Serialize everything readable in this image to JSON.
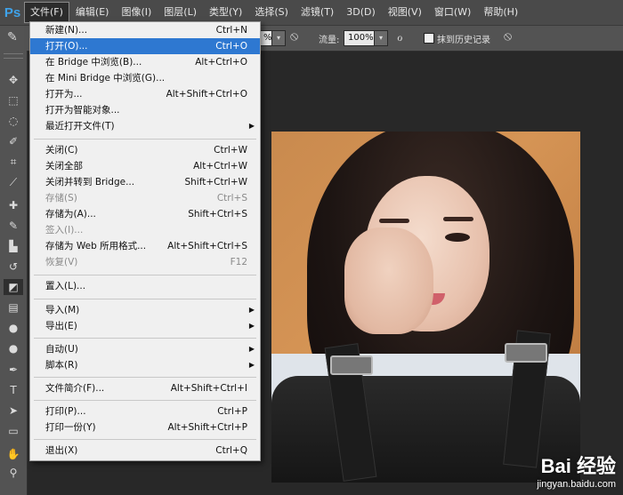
{
  "menubar": {
    "logo": "Ps",
    "items": [
      "文件(F)",
      "编辑(E)",
      "图像(I)",
      "图层(L)",
      "类型(Y)",
      "选择(S)",
      "滤镜(T)",
      "3D(D)",
      "视图(V)",
      "窗口(W)",
      "帮助(H)"
    ]
  },
  "options": {
    "opacity_value": "%",
    "flow_label": "流量:",
    "flow_value": "100%",
    "history_label": "抹到历史记录"
  },
  "file_menu": {
    "items": [
      {
        "label": "新建(N)...",
        "shortcut": "Ctrl+N"
      },
      {
        "label": "打开(O)...",
        "shortcut": "Ctrl+O",
        "highlighted": true
      },
      {
        "label": "在 Bridge 中浏览(B)...",
        "shortcut": "Alt+Ctrl+O"
      },
      {
        "label": "在 Mini Bridge 中浏览(G)...",
        "shortcut": ""
      },
      {
        "label": "打开为...",
        "shortcut": "Alt+Shift+Ctrl+O"
      },
      {
        "label": "打开为智能对象...",
        "shortcut": ""
      },
      {
        "label": "最近打开文件(T)",
        "shortcut": "",
        "submenu": true
      },
      {
        "label": "关闭(C)",
        "shortcut": "Ctrl+W"
      },
      {
        "label": "关闭全部",
        "shortcut": "Alt+Ctrl+W"
      },
      {
        "label": "关闭并转到 Bridge...",
        "shortcut": "Shift+Ctrl+W"
      },
      {
        "label": "存储(S)",
        "shortcut": "Ctrl+S",
        "disabled": true
      },
      {
        "label": "存储为(A)...",
        "shortcut": "Shift+Ctrl+S"
      },
      {
        "label": "签入(I)...",
        "shortcut": "",
        "disabled": true
      },
      {
        "label": "存储为 Web 所用格式...",
        "shortcut": "Alt+Shift+Ctrl+S"
      },
      {
        "label": "恢复(V)",
        "shortcut": "F12",
        "disabled": true
      },
      {
        "label": "置入(L)...",
        "shortcut": ""
      },
      {
        "label": "导入(M)",
        "shortcut": "",
        "submenu": true
      },
      {
        "label": "导出(E)",
        "shortcut": "",
        "submenu": true
      },
      {
        "label": "自动(U)",
        "shortcut": "",
        "submenu": true
      },
      {
        "label": "脚本(R)",
        "shortcut": "",
        "submenu": true
      },
      {
        "label": "文件简介(F)...",
        "shortcut": "Alt+Shift+Ctrl+I"
      },
      {
        "label": "打印(P)...",
        "shortcut": "Ctrl+P"
      },
      {
        "label": "打印一份(Y)",
        "shortcut": "Alt+Shift+Ctrl+P"
      },
      {
        "label": "退出(X)",
        "shortcut": "Ctrl+Q"
      }
    ]
  },
  "watermark": {
    "main": "Bai 经验",
    "sub": "jingyan.baidu.com"
  },
  "colors": {
    "menu_highlight": "#2e78d1",
    "ps_blue": "#3fa3ea",
    "ui_dark": "#282828"
  },
  "icons": [
    "move-icon",
    "marquee-icon",
    "lasso-icon",
    "quick-select-icon",
    "crop-icon",
    "eyedropper-icon",
    "healing-icon",
    "brush-icon",
    "stamp-icon",
    "history-brush-icon",
    "eraser-icon",
    "gradient-icon",
    "blur-icon",
    "dodge-icon",
    "pen-icon",
    "type-icon",
    "path-select-icon",
    "shape-icon",
    "hand-icon",
    "zoom-icon"
  ]
}
